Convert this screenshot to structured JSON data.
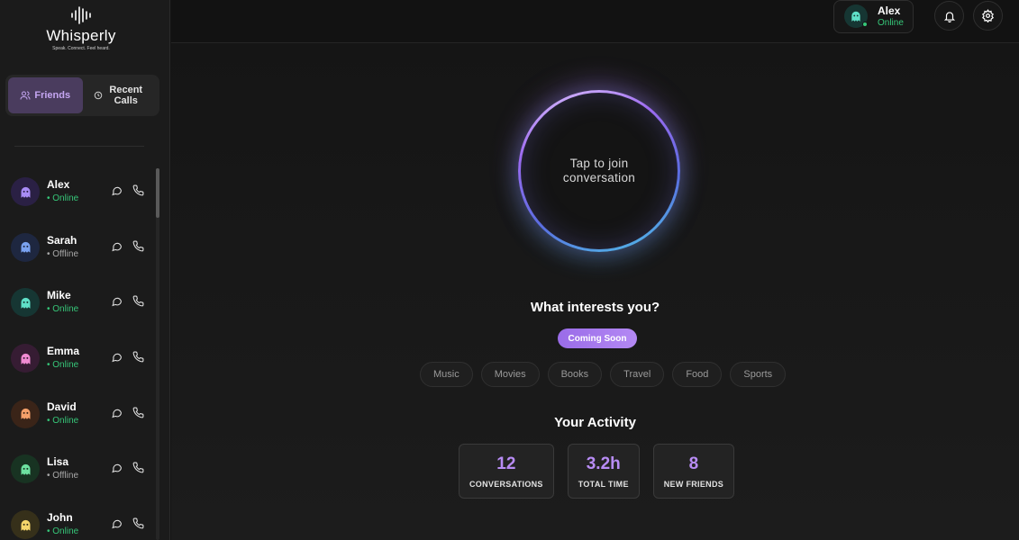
{
  "app": {
    "name": "Whisperly",
    "tagline": "Speak. Connect. Feel heard."
  },
  "sidebar": {
    "tabs": [
      {
        "label": "Friends",
        "icon": "users-icon",
        "active": true
      },
      {
        "label": "Recent Calls",
        "icon": "clock-icon",
        "active": false
      }
    ],
    "friends": [
      {
        "name": "Alex",
        "status": "Online",
        "online": true,
        "avatar_color": "#2a2044",
        "ghost_color": "#a88cf5"
      },
      {
        "name": "Sarah",
        "status": "Offline",
        "online": false,
        "avatar_color": "#1e2740",
        "ghost_color": "#7aa2f0"
      },
      {
        "name": "Mike",
        "status": "Online",
        "online": true,
        "avatar_color": "#163633",
        "ghost_color": "#5fe0c8"
      },
      {
        "name": "Emma",
        "status": "Online",
        "online": true,
        "avatar_color": "#361c33",
        "ghost_color": "#f08ad2"
      },
      {
        "name": "David",
        "status": "Online",
        "online": true,
        "avatar_color": "#3a2418",
        "ghost_color": "#f5a06a"
      },
      {
        "name": "Lisa",
        "status": "Offline",
        "online": false,
        "avatar_color": "#183322",
        "ghost_color": "#6de0a0"
      },
      {
        "name": "John",
        "status": "Online",
        "online": true,
        "avatar_color": "#36301a",
        "ghost_color": "#f5d66a"
      }
    ]
  },
  "header": {
    "user": {
      "name": "Alex",
      "status": "Online"
    }
  },
  "main": {
    "orb_text": "Tap to join conversation",
    "interests_title": "What interests you?",
    "badge": "Coming Soon",
    "interests": [
      "Music",
      "Movies",
      "Books",
      "Travel",
      "Food",
      "Sports"
    ],
    "activity_title": "Your Activity",
    "stats": [
      {
        "value": "12",
        "label": "CONVERSATIONS"
      },
      {
        "value": "3.2h",
        "label": "TOTAL TIME"
      },
      {
        "value": "8",
        "label": "NEW FRIENDS"
      }
    ]
  },
  "colors": {
    "accent": "#b88cf5",
    "online": "#36c779"
  }
}
